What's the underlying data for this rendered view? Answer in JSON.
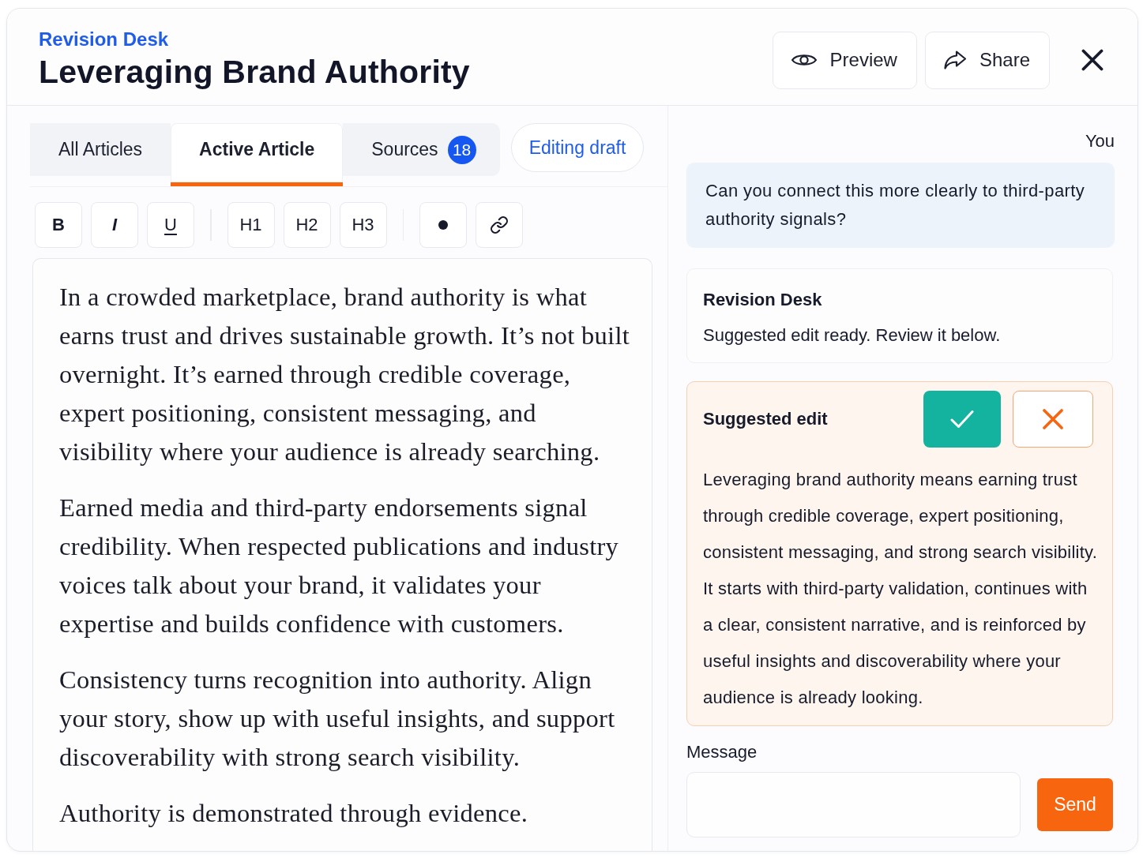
{
  "header": {
    "app_name": "Revision Desk",
    "title": "Leveraging Brand Authority",
    "actions": [
      {
        "kind": "preview",
        "label": "Preview"
      },
      {
        "kind": "share",
        "label": "Share"
      },
      {
        "kind": "close"
      }
    ]
  },
  "tabs": [
    {
      "label": "All Articles",
      "selected": false
    },
    {
      "label": "Active Article",
      "selected": true
    },
    {
      "label": "Sources",
      "badge": "18",
      "selected": false
    }
  ],
  "status_pill": "Editing draft",
  "toolbar": [
    {
      "kind": "bold",
      "label": "B"
    },
    {
      "kind": "italic",
      "label": "I"
    },
    {
      "kind": "underline",
      "label": "U"
    },
    {
      "kind": "separator"
    },
    {
      "kind": "heading",
      "label": "H1"
    },
    {
      "kind": "heading",
      "label": "H2"
    },
    {
      "kind": "heading",
      "label": "H3"
    },
    {
      "kind": "separator"
    },
    {
      "kind": "bullet"
    },
    {
      "kind": "link"
    }
  ],
  "editor": {
    "paragraphs": [
      "In a crowded marketplace, brand authority is what earns trust and drives sustainable growth. It’s not built overnight. It’s earned through credible coverage, expert positioning, consistent messaging, and visibility where your audience is already searching.",
      "Earned media and third-party endorsements signal credibility. When respected publications and industry voices talk about your brand, it validates your expertise and builds confidence with customers.",
      "Consistency turns recognition into authority. Align your story, show up with useful insights, and support discoverability with strong search visibility.",
      "Authority is demonstrated through evidence."
    ]
  },
  "chat": {
    "messages": [
      {
        "kind": "user",
        "author": "You",
        "text": "Can you connect this more clearly to third-party authority signals?"
      },
      {
        "kind": "assistant",
        "author": "Revision Desk",
        "text": "Suggested edit ready. Review it below."
      }
    ],
    "suggestion": {
      "title": "Suggested edit",
      "actions": [
        {
          "kind": "accept"
        },
        {
          "kind": "reject"
        }
      ],
      "text": "Leveraging brand authority means earning trust through credible coverage, expert positioning, consistent messaging, and strong search visibility. It starts with third-party validation, continues with a clear, consistent narrative, and is reinforced by useful insights and discoverability where your audience is already looking."
    }
  },
  "composer": {
    "label": "Message",
    "send": "Send"
  }
}
